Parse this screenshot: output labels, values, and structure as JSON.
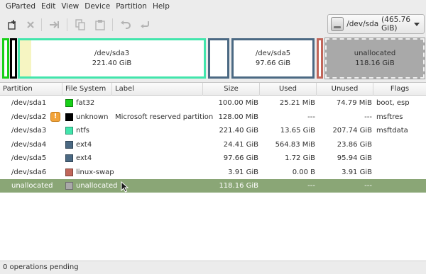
{
  "menu": [
    "GParted",
    "Edit",
    "View",
    "Device",
    "Partition",
    "Help"
  ],
  "toolbar": {
    "buttons": [
      "new-partition-icon",
      "delete-icon",
      "resize-move-icon",
      "copy-icon",
      "paste-icon",
      "undo-icon",
      "apply-icon"
    ]
  },
  "device": {
    "name": "/dev/sda",
    "size": "(465.76 GiB)",
    "icon": "harddisk-icon"
  },
  "partition_map": {
    "sda3": {
      "name": "/dev/sda3",
      "size": "221.40 GiB",
      "used_fraction": 0.06
    },
    "sda5": {
      "name": "/dev/sda5",
      "size": "97.66 GiB"
    },
    "unallocated": {
      "name": "unallocated",
      "size": "118.16 GiB"
    }
  },
  "columns": [
    "Partition",
    "File System",
    "Label",
    "Size",
    "Used",
    "Unused",
    "Flags"
  ],
  "rows": [
    {
      "partition": "/dev/sda1",
      "fs": "fat32",
      "color": "#18d018",
      "label": "",
      "size": "100.00 MiB",
      "used": "25.21 MiB",
      "unused": "74.79 MiB",
      "flags": "boot, esp"
    },
    {
      "partition": "/dev/sda2",
      "fs": "unknown",
      "color": "#000000",
      "label": "Microsoft reserved partition",
      "size": "128.00 MiB",
      "used": "---",
      "unused": "---",
      "flags": "msftres",
      "warning": "!"
    },
    {
      "partition": "/dev/sda3",
      "fs": "ntfs",
      "color": "#42e5ac",
      "label": "",
      "size": "221.40 GiB",
      "used": "13.65 GiB",
      "unused": "207.74 GiB",
      "flags": "msftdata"
    },
    {
      "partition": "/dev/sda4",
      "fs": "ext4",
      "color": "#4b6983",
      "label": "",
      "size": "24.41 GiB",
      "used": "564.83 MiB",
      "unused": "23.86 GiB",
      "flags": ""
    },
    {
      "partition": "/dev/sda5",
      "fs": "ext4",
      "color": "#4b6983",
      "label": "",
      "size": "97.66 GiB",
      "used": "1.72 GiB",
      "unused": "95.94 GiB",
      "flags": ""
    },
    {
      "partition": "/dev/sda6",
      "fs": "linux-swap",
      "color": "#c1665a",
      "label": "",
      "size": "3.91 GiB",
      "used": "0.00 B",
      "unused": "3.91 GiB",
      "flags": ""
    },
    {
      "partition": "unallocated",
      "fs": "unallocated",
      "color": "#a9a9a9",
      "label": "",
      "size": "118.16 GiB",
      "used": "---",
      "unused": "---",
      "flags": "",
      "selected": true
    }
  ],
  "status": "0 operations pending"
}
